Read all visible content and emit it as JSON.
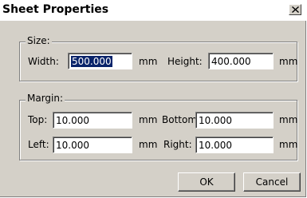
{
  "window": {
    "title": "Sheet Properties"
  },
  "size": {
    "legend": "Size:",
    "width_label": "Width:",
    "width_value": "500.000",
    "width_unit": "mm",
    "height_label": "Height:",
    "height_value": "400.000",
    "height_unit": "mm"
  },
  "margin": {
    "legend": "Margin:",
    "top_label": "Top:",
    "top_value": "10.000",
    "top_unit": "mm",
    "bottom_label": "Bottom:",
    "bottom_value": "10.000",
    "bottom_unit": "mm",
    "left_label": "Left:",
    "left_value": "10.000",
    "left_unit": "mm",
    "right_label": "Right:",
    "right_value": "10.000",
    "right_unit": "mm"
  },
  "buttons": {
    "ok": "OK",
    "cancel": "Cancel"
  },
  "icons": {
    "close": "close-icon"
  },
  "colors": {
    "dialog_face": "#d4d0c8",
    "selection": "#0a246a"
  }
}
